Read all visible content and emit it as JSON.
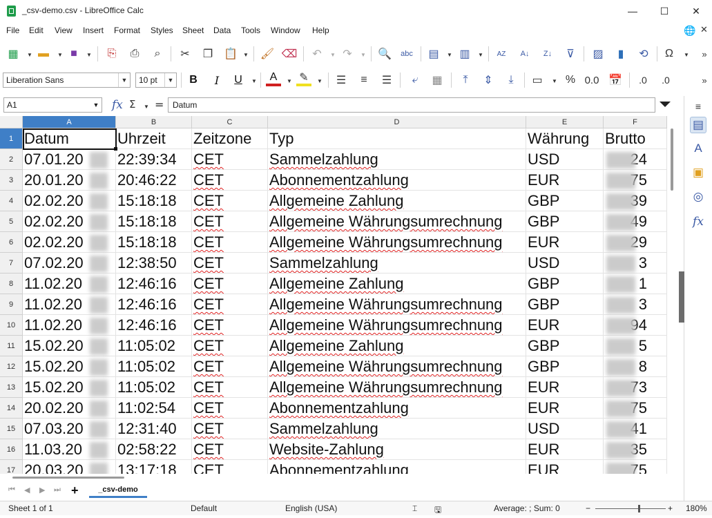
{
  "window": {
    "title": "_csv-demo.csv - LibreOffice Calc",
    "minimize": "—",
    "maximize": "☐",
    "close": "✕"
  },
  "menu": [
    "File",
    "Edit",
    "View",
    "Insert",
    "Format",
    "Styles",
    "Sheet",
    "Data",
    "Tools",
    "Window",
    "Help"
  ],
  "toolbar": {
    "font_name": "Liberation Sans",
    "font_size": "10 pt",
    "bold": "B",
    "italic": "I",
    "underline": "U",
    "percent": "%",
    "number_format": "0.0",
    "add_decimal": ".0",
    "remove_decimal": ".0"
  },
  "formula_bar": {
    "name_box": "A1",
    "fx": "fx",
    "sigma": "Σ",
    "equals": "=",
    "content": "Datum"
  },
  "sheet": {
    "columns": [
      "A",
      "B",
      "C",
      "D",
      "E",
      "F"
    ],
    "rows": [
      {
        "n": "1",
        "cells": [
          "Datum",
          "Uhrzeit",
          "Zeitzone",
          "Typ",
          "Währung",
          "Brutto"
        ]
      },
      {
        "n": "2",
        "cells": [
          "07.01.20",
          "22:39:34",
          "CET",
          "Sammelzahlung",
          "USD",
          "24"
        ]
      },
      {
        "n": "3",
        "cells": [
          "20.01.20",
          "20:46:22",
          "CET",
          "Abonnementzahlung",
          "EUR",
          "75"
        ]
      },
      {
        "n": "4",
        "cells": [
          "02.02.20",
          "15:18:18",
          "CET",
          "Allgemeine Zahlung",
          "GBP",
          "39"
        ]
      },
      {
        "n": "5",
        "cells": [
          "02.02.20",
          "15:18:18",
          "CET",
          "Allgemeine Währungsumrechnung",
          "GBP",
          "49"
        ]
      },
      {
        "n": "6",
        "cells": [
          "02.02.20",
          "15:18:18",
          "CET",
          "Allgemeine Währungsumrechnung",
          "EUR",
          "29"
        ]
      },
      {
        "n": "7",
        "cells": [
          "07.02.20",
          "12:38:50",
          "CET",
          "Sammelzahlung",
          "USD",
          "3"
        ]
      },
      {
        "n": "8",
        "cells": [
          "11.02.20",
          "12:46:16",
          "CET",
          "Allgemeine Zahlung",
          "GBP",
          "1"
        ]
      },
      {
        "n": "9",
        "cells": [
          "11.02.20",
          "12:46:16",
          "CET",
          "Allgemeine Währungsumrechnung",
          "GBP",
          "3"
        ]
      },
      {
        "n": "10",
        "cells": [
          "11.02.20",
          "12:46:16",
          "CET",
          "Allgemeine Währungsumrechnung",
          "EUR",
          "94"
        ]
      },
      {
        "n": "11",
        "cells": [
          "15.02.20",
          "11:05:02",
          "CET",
          "Allgemeine Zahlung",
          "GBP",
          "5"
        ]
      },
      {
        "n": "12",
        "cells": [
          "15.02.20",
          "11:05:02",
          "CET",
          "Allgemeine Währungsumrechnung",
          "GBP",
          "8"
        ]
      },
      {
        "n": "13",
        "cells": [
          "15.02.20",
          "11:05:02",
          "CET",
          "Allgemeine Währungsumrechnung",
          "EUR",
          "73"
        ]
      },
      {
        "n": "14",
        "cells": [
          "20.02.20",
          "11:02:54",
          "CET",
          "Abonnementzahlung",
          "EUR",
          "75"
        ]
      },
      {
        "n": "15",
        "cells": [
          "07.03.20",
          "12:31:40",
          "CET",
          "Sammelzahlung",
          "USD",
          "41"
        ]
      },
      {
        "n": "16",
        "cells": [
          "11.03.20",
          "02:58:22",
          "CET",
          "Website-Zahlung",
          "EUR",
          "35"
        ]
      },
      {
        "n": "17",
        "cells": [
          "20.03.20",
          "13:17:18",
          "CET",
          "Abonnementzahlung",
          "EUR",
          "75"
        ]
      }
    ]
  },
  "tabs": {
    "add": "+",
    "sheet_name": "_csv-demo"
  },
  "status": {
    "sheet": "Sheet 1 of 1",
    "page_style": "Default",
    "language": "English (USA)",
    "summary": "Average: ; Sum: 0",
    "zoom": "180%",
    "zoom_minus": "−",
    "zoom_plus": "+"
  },
  "colors": {
    "selection": "#3f7fc7",
    "spell_error": "#e02020",
    "icon_blue": "#3b5aa5"
  }
}
